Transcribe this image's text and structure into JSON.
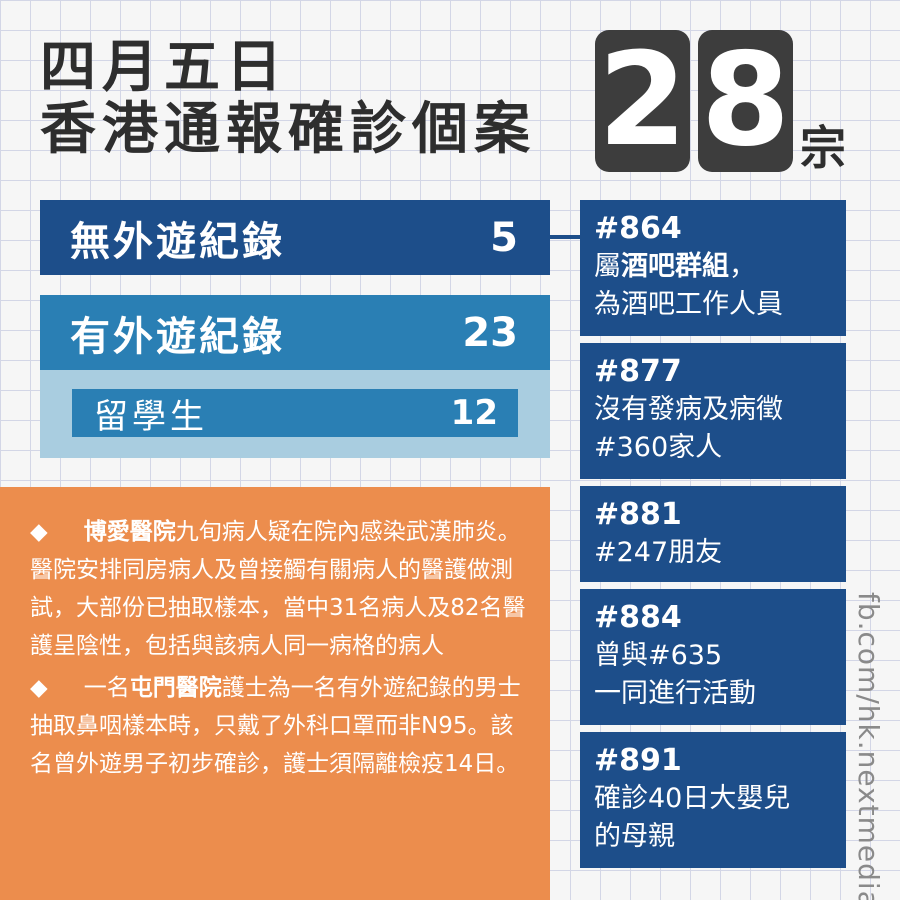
{
  "header": {
    "line1": "四月五日",
    "line2": "香港通報確診個案",
    "digit1": "2",
    "digit2": "8",
    "unit": "宗"
  },
  "stats": {
    "no_travel": {
      "label": "無外遊紀錄",
      "value": "5"
    },
    "travel": {
      "label": "有外遊紀錄",
      "value": "23"
    },
    "students": {
      "label": "留學生",
      "value": "12"
    }
  },
  "cases": [
    {
      "id": "#864",
      "line1_pre": "屬",
      "line1_bold": "酒吧群組",
      "line1_post": "，",
      "line2": "為酒吧工作人員"
    },
    {
      "id": "#877",
      "line1": "沒有發病及病徵",
      "line2": "#360家人"
    },
    {
      "id": "#881",
      "line1": "#247朋友"
    },
    {
      "id": "#884",
      "line1": "曾與#635",
      "line2": "一同進行活動"
    },
    {
      "id": "#891",
      "line1": "確診40日大嬰兒",
      "line2": "的母親"
    }
  ],
  "notes": [
    {
      "bullet": "◆",
      "bold": "博愛醫院",
      "lead": "",
      "text": "九旬病人疑在院內感染武漢肺炎。醫院安排同房病人及曾接觸有關病人的醫護做測試，大部份已抽取樣本，當中31名病人及82名醫護呈陰性，包括與該病人同一病格的病人"
    },
    {
      "bullet": "◆",
      "lead": "一名",
      "bold": "屯門醫院",
      "text": "護士為一名有外遊紀錄的男士抽取鼻咽樣本時，只戴了外科口罩而非N95。該名曾外遊男子初步確診，護士須隔離檢疫14日。"
    }
  ],
  "credit": "fb.com/hk.nextmedia/",
  "colors": {
    "dark_blue": "#1d4e8a",
    "mid_blue": "#2a7fb4",
    "light_blue": "#a9cde0",
    "orange": "#ec8d4d",
    "title": "#2e2e2e",
    "digit_bg": "#3d3d3d"
  }
}
